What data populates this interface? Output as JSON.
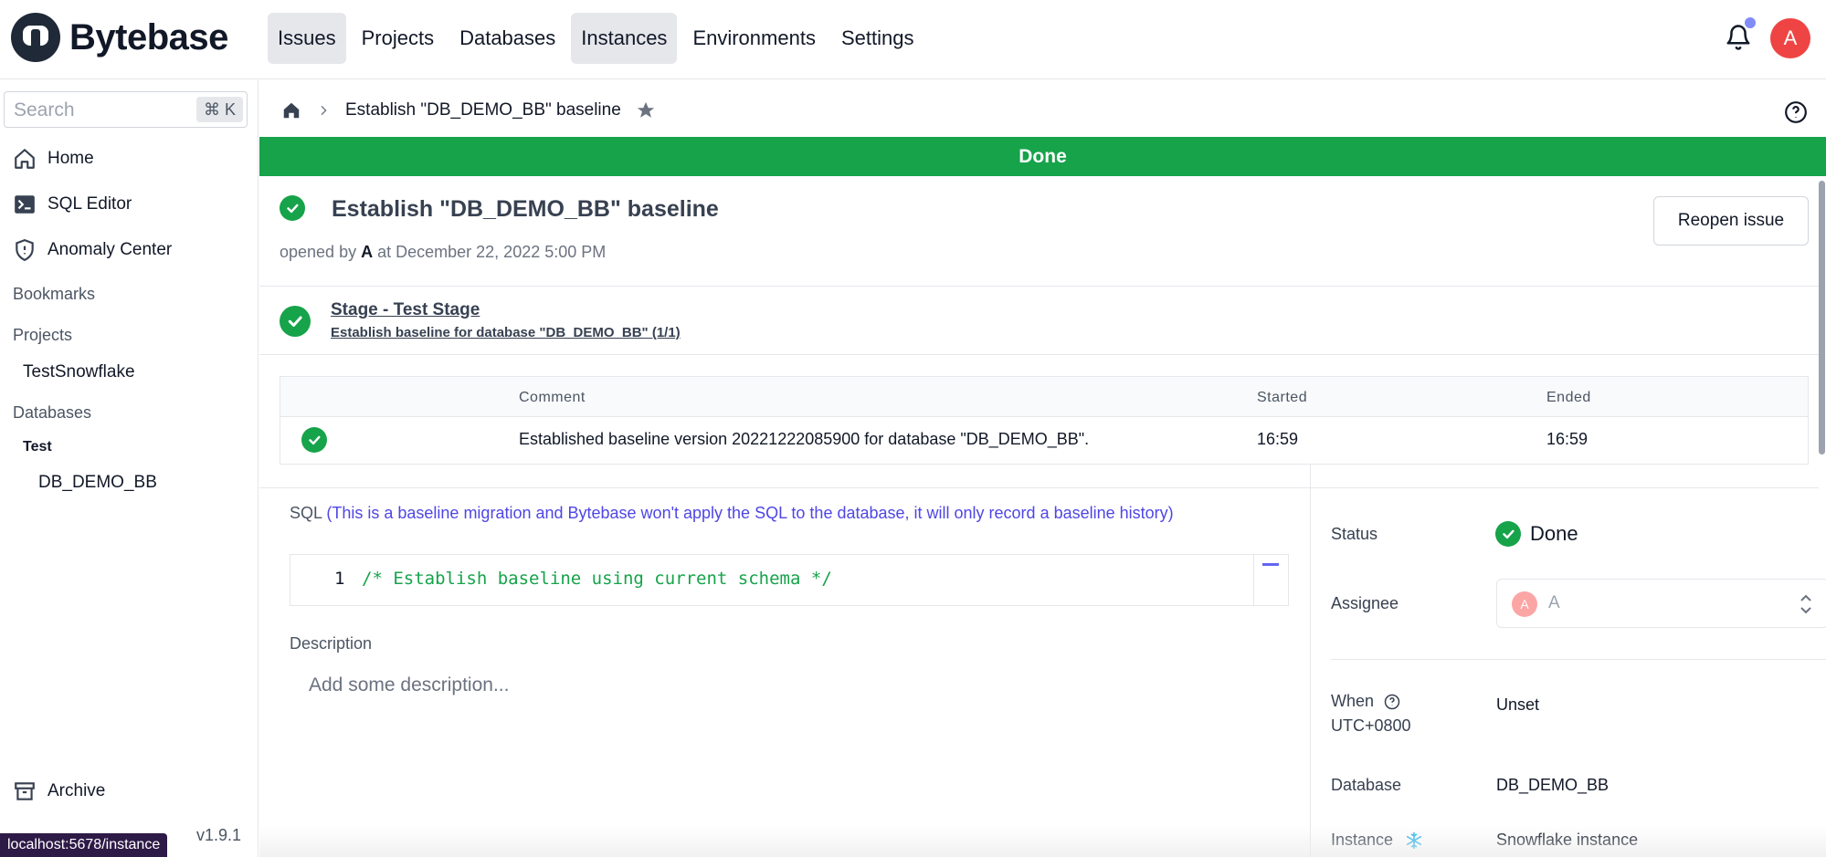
{
  "brand": {
    "name": "Bytebase"
  },
  "nav": {
    "items": [
      {
        "label": "Issues",
        "active": true
      },
      {
        "label": "Projects",
        "active": false
      },
      {
        "label": "Databases",
        "active": false
      },
      {
        "label": "Instances",
        "active": true
      },
      {
        "label": "Environments",
        "active": false
      },
      {
        "label": "Settings",
        "active": false
      }
    ],
    "avatar_initial": "A"
  },
  "sidebar": {
    "search_placeholder": "Search",
    "search_shortcut": "⌘ K",
    "home": "Home",
    "sql_editor": "SQL Editor",
    "anomaly_center": "Anomaly Center",
    "bookmarks": "Bookmarks",
    "projects_label": "Projects",
    "project_item": "TestSnowflake",
    "databases_label": "Databases",
    "env_group": "Test",
    "database_item": "DB_DEMO_BB",
    "archive": "Archive",
    "version": "v1.9.1",
    "url_tooltip": "localhost:5678/instance"
  },
  "breadcrumb": {
    "current": "Establish \"DB_DEMO_BB\" baseline"
  },
  "banner": {
    "text": "Done",
    "color": "#16a34a"
  },
  "issue": {
    "title": "Establish \"DB_DEMO_BB\" baseline",
    "opened_prefix": "opened by",
    "opened_by": "A",
    "opened_at": "at December 22, 2022 5:00 PM",
    "reopen_label": "Reopen issue"
  },
  "stage": {
    "title": "Stage - Test Stage",
    "subtitle": "Establish baseline for database \"DB_DEMO_BB\" (1/1)"
  },
  "task_table": {
    "headers": {
      "comment": "Comment",
      "started": "Started",
      "ended": "Ended"
    },
    "row": {
      "comment": "Established baseline version 20221222085900 for database \"DB_DEMO_BB\".",
      "started": "16:59",
      "ended": "16:59"
    }
  },
  "sql": {
    "label": "SQL",
    "note": "(This is a baseline migration and Bytebase won't apply the SQL to the database, it will only record a baseline history)",
    "line_number": "1",
    "code": "/* Establish baseline using current schema */"
  },
  "description": {
    "label": "Description",
    "placeholder": "Add some description..."
  },
  "properties": {
    "status_label": "Status",
    "status_value": "Done",
    "assignee_label": "Assignee",
    "assignee_initial": "A",
    "assignee_name": "A",
    "when_label": "When",
    "when_tz": "UTC+0800",
    "when_value": "Unset",
    "database_label": "Database",
    "database_value": "DB_DEMO_BB",
    "instance_label": "Instance",
    "instance_value": "Snowflake instance"
  }
}
